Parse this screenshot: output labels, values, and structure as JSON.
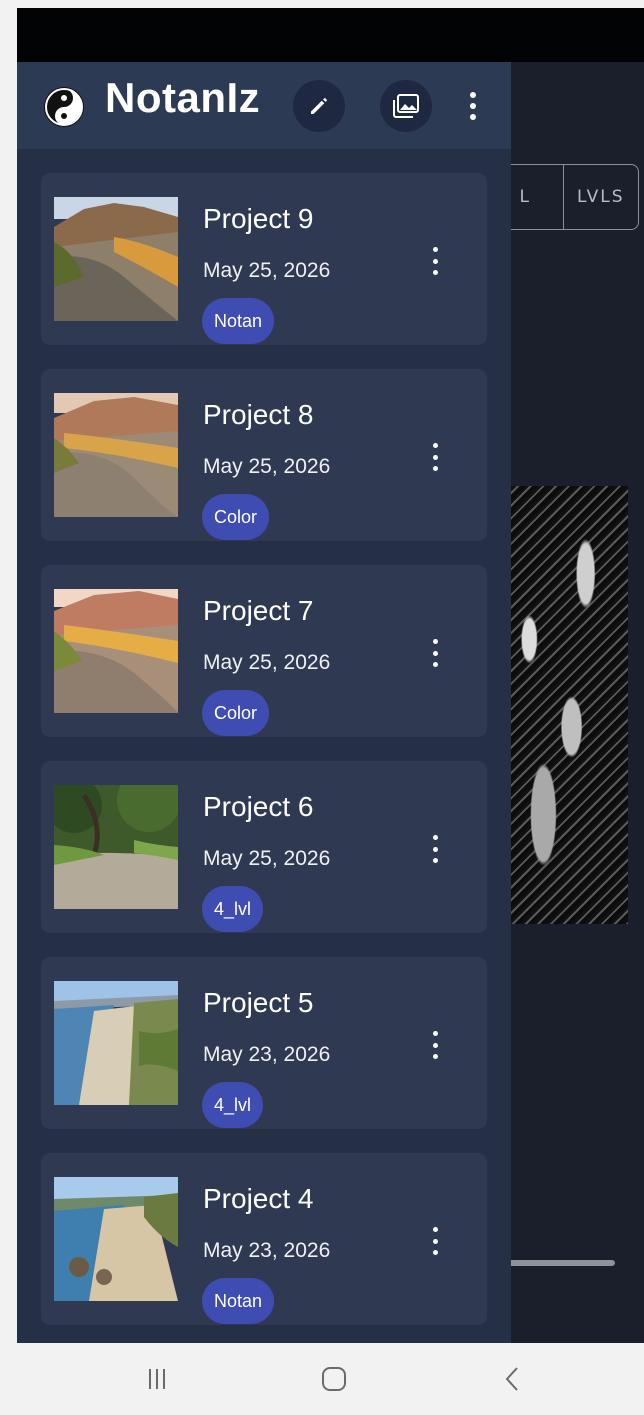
{
  "app": {
    "title": "NotanIz"
  },
  "header": {
    "icons": [
      "yin-yang-icon",
      "pencil-icon",
      "gallery-icon",
      "more-vert-icon"
    ]
  },
  "background": {
    "segment_labels": [
      "L",
      "LVLS"
    ]
  },
  "projects": [
    {
      "title": "Project 9",
      "date": "May 25, 2026",
      "tag": "Notan"
    },
    {
      "title": "Project 8",
      "date": "May 25, 2026",
      "tag": "Color"
    },
    {
      "title": "Project 7",
      "date": "May 25, 2026",
      "tag": "Color"
    },
    {
      "title": "Project 6",
      "date": "May 25, 2026",
      "tag": "4_lvl"
    },
    {
      "title": "Project 5",
      "date": "May 23, 2026",
      "tag": "4_lvl"
    },
    {
      "title": "Project 4",
      "date": "May 23, 2026",
      "tag": "Notan"
    }
  ],
  "colors": {
    "drawer": "#252f45",
    "card": "#2f3a52",
    "badge": "#3f4db3",
    "header": "#2d3a53"
  },
  "nav": {
    "icons": [
      "recent-apps-icon",
      "home-icon",
      "back-icon"
    ]
  }
}
